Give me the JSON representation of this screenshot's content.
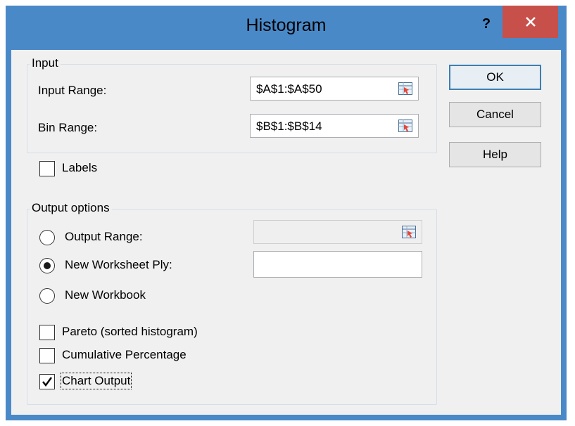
{
  "dialog": {
    "title": "Histogram",
    "help_glyph": "?",
    "colors": {
      "titlebar": "#4a89c8",
      "close": "#c7504a",
      "client": "#f0f0f0"
    }
  },
  "input": {
    "group_title": "Input",
    "input_range_label": "Input Range:",
    "input_range_value": "$A$1:$A$50",
    "bin_range_label": "Bin Range:",
    "bin_range_value": "$B$1:$B$14"
  },
  "labels_checkbox": {
    "label": "Labels",
    "checked": false
  },
  "output": {
    "group_title": "Output options",
    "output_range_label": "Output Range:",
    "output_range_value": "",
    "new_ply_label": "New Worksheet Ply:",
    "new_ply_value": "",
    "new_workbook_label": "New Workbook",
    "selected": "new_worksheet_ply",
    "pareto_label": "Pareto (sorted histogram)",
    "pareto_checked": false,
    "cumulative_label": "Cumulative Percentage",
    "cumulative_checked": false,
    "chart_label": "Chart Output",
    "chart_checked": true
  },
  "buttons": {
    "ok": "OK",
    "cancel": "Cancel",
    "help": "Help"
  }
}
